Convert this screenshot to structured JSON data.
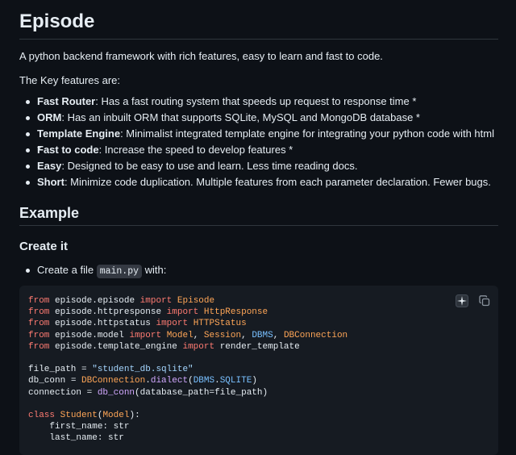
{
  "title": "Episode",
  "intro": "A python backend framework with rich features, easy to learn and fast to code.",
  "key_features_intro": "The Key features are:",
  "features": [
    {
      "name": "Fast Router",
      "desc": ": Has a fast routing system that speeds up request to response time *"
    },
    {
      "name": "ORM",
      "desc": ": Has an inbuilt ORM that supports SQLite, MySQL and MongoDB database *"
    },
    {
      "name": "Template Engine",
      "desc": ": Minimalist integrated template engine for integrating your python code with html *"
    },
    {
      "name": "Fast to code",
      "desc": ": Increase the speed to develop features *"
    },
    {
      "name": "Easy",
      "desc": ": Designed to be easy to use and learn. Less time reading docs."
    },
    {
      "name": "Short",
      "desc": ": Minimize code duplication. Multiple features from each parameter declaration. Fewer bugs."
    }
  ],
  "example_heading": "Example",
  "create_heading": "Create it",
  "create_step": {
    "before": "Create a file ",
    "filename": "main.py",
    "after": " with:"
  },
  "code_lines": [
    "from episode.episode import Episode",
    "from episode.httpresponse import HttpResponse",
    "from episode.httpstatus import HTTPStatus",
    "from episode.model import Model, Session, DBMS, DBConnection",
    "from episode.template_engine import render_template",
    "",
    "file_path = \"student_db.sqlite\"",
    "db_conn = DBConnection.dialect(DBMS.SQLITE)",
    "connection = db_conn(database_path=file_path)",
    "",
    "class Student(Model):",
    "    first_name: str",
    "    last_name: str"
  ],
  "icons": {
    "ai": "sparkle-icon",
    "copy": "copy-icon"
  },
  "colors": {
    "background": "#0d1117",
    "code_bg": "#161b22",
    "keyword": "#ff7b72",
    "class": "#ffa657",
    "function": "#d2a8ff",
    "constant": "#79c0ff",
    "string": "#a5d6ff"
  }
}
